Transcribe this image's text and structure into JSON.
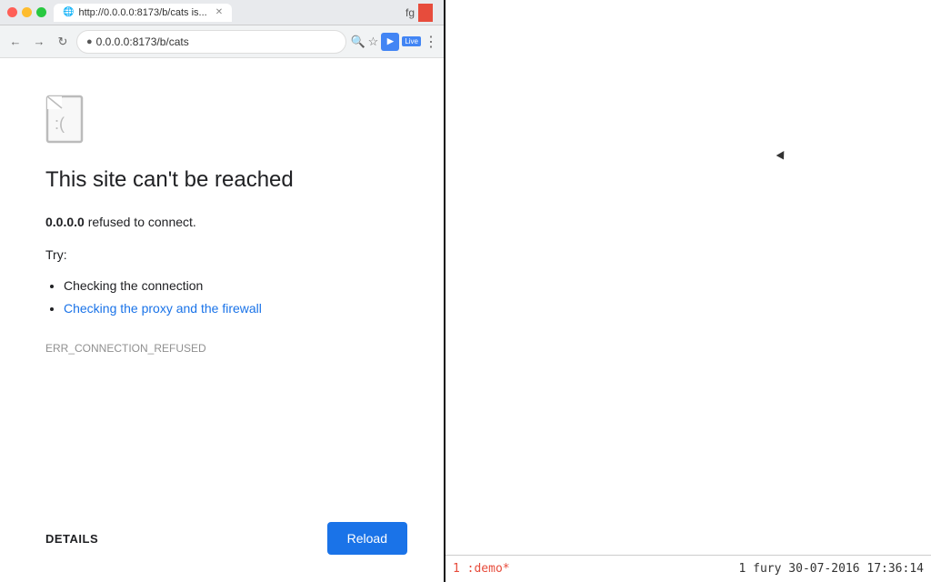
{
  "browser": {
    "tab_title": "http://0.0.0.0:8173/b/cats is...",
    "tab_favicon": "📄",
    "url": "0.0.0.0:8173/b/cats",
    "url_full": "http://0.0.0.0:8173/b/cats",
    "fg_label": "fg",
    "error_title": "This site can't be reached",
    "error_subtitle_host": "0.0.0.0",
    "error_subtitle_msg": " refused to connect.",
    "try_label": "Try:",
    "try_items": [
      {
        "text": "Checking the connection",
        "link": false
      },
      {
        "text": "Checking the proxy and the firewall",
        "link": true
      }
    ],
    "error_code": "ERR_CONNECTION_REFUSED",
    "details_label": "DETAILS",
    "reload_label": "Reload"
  },
  "terminal": {
    "status_left": "1 :demo*",
    "status_right": "1  fury  30-07-2016  17:36:14"
  }
}
